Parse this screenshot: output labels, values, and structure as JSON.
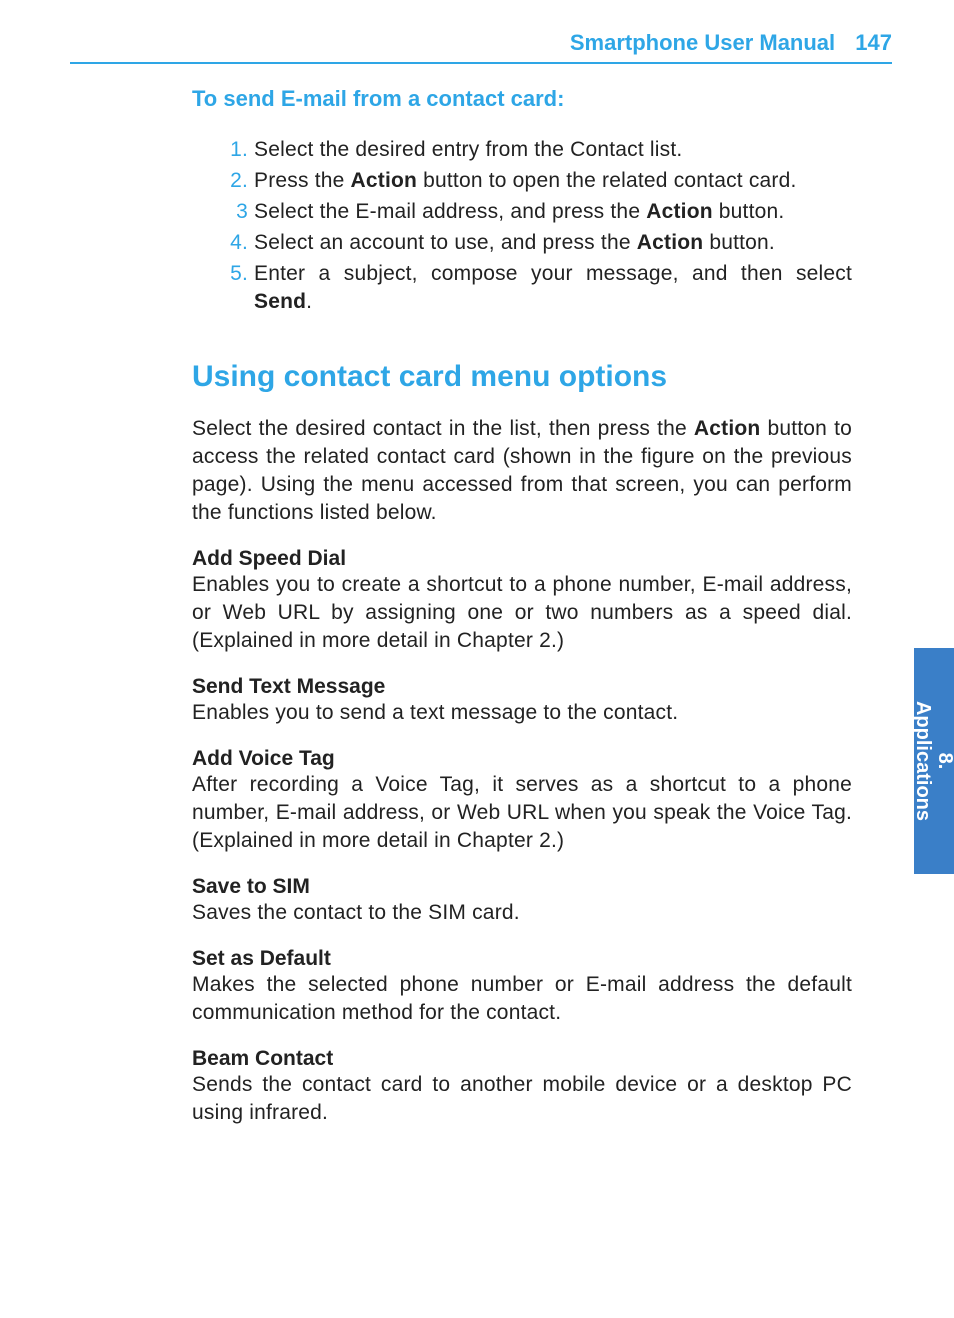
{
  "header": {
    "title": "Smartphone User Manual",
    "page_num": "147"
  },
  "section1": {
    "heading": "To send E-mail from a contact card:",
    "steps": [
      {
        "n": "1.",
        "text": "Select the desired entry from the Contact list."
      },
      {
        "n": "2.",
        "text_before": "Press the ",
        "bold1": "Action",
        "text_after": " button to open the related contact card."
      },
      {
        "n": "3",
        "text_before": "Select the E-mail address, and press the ",
        "bold1": "Action",
        "text_after": " button."
      },
      {
        "n": "4.",
        "text_before": "Select an account to use, and press the ",
        "bold1": "Action",
        "text_after": " button."
      },
      {
        "n": "5.",
        "text_before": "Enter a subject, compose your message, and then select ",
        "bold1": "Send",
        "text_after": "."
      }
    ]
  },
  "section2": {
    "heading": "Using contact card menu options",
    "intro_before": "Select the desired contact in the list, then press the ",
    "intro_bold": "Action",
    "intro_after": " button to access the related contact card (shown in the figure on the previous page).  Using the menu accessed from that screen, you can perform the functions listed below.",
    "options": [
      {
        "title": "Add Speed Dial",
        "desc": "Enables you to create a shortcut to a phone number, E-mail address, or Web URL by assigning one or two numbers as a speed dial.  (Explained in more detail in Chapter 2.)"
      },
      {
        "title": "Send Text Message",
        "desc": "Enables you to send a text message to the contact."
      },
      {
        "title": "Add Voice Tag",
        "desc": "After recording a Voice Tag, it serves as a shortcut to a phone number, E-mail address, or Web URL when you speak the Voice Tag.  (Explained in more detail in Chapter 2.)"
      },
      {
        "title": "Save to SIM",
        "desc": "Saves the contact to the SIM card."
      },
      {
        "title": "Set as Default",
        "desc": "Makes the selected phone number or E-mail address the default communication method for the contact."
      },
      {
        "title": "Beam Contact",
        "desc": "Sends the contact card to another mobile device or a desktop PC using infrared."
      }
    ]
  },
  "side_tab": {
    "line1": "8.",
    "line2": "Applications"
  }
}
